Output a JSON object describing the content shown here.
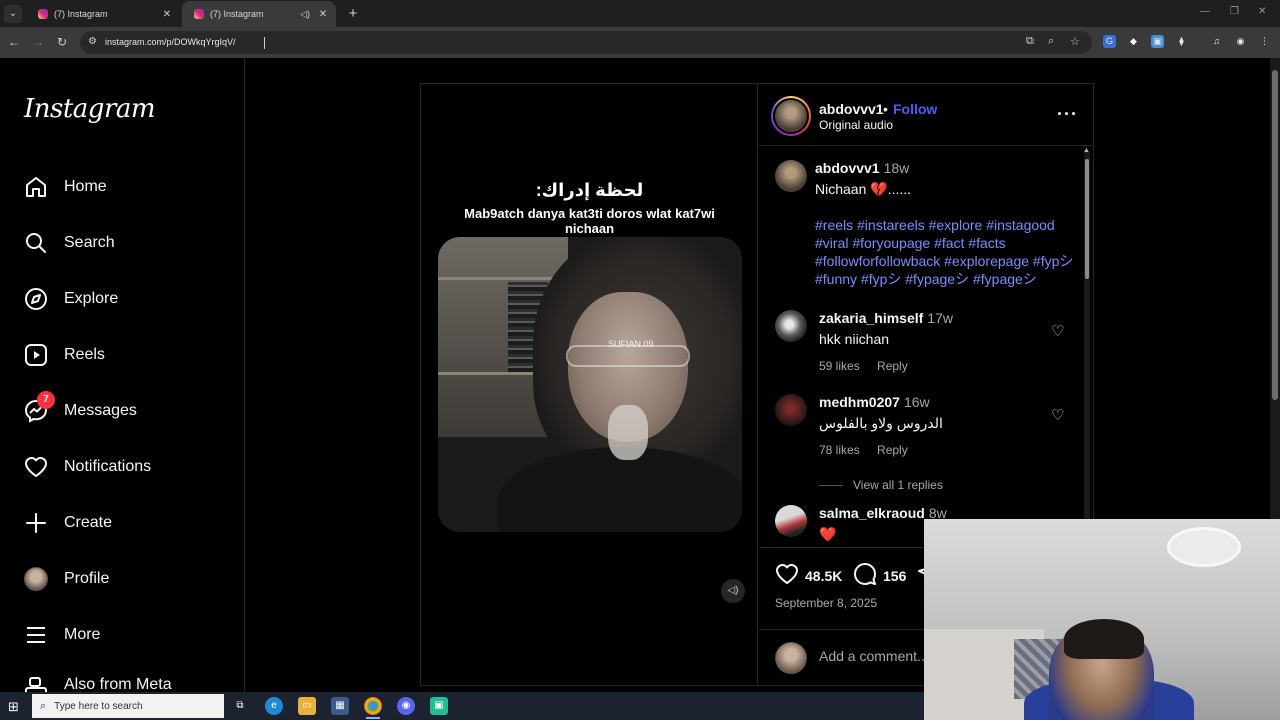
{
  "browser": {
    "tabs": [
      {
        "title": "(7) Instagram",
        "active": false
      },
      {
        "title": "(7) Instagram",
        "active": true
      }
    ],
    "url": "instagram.com/p/DOWkqYrgIqV/"
  },
  "instagram": {
    "logo": "Instagram",
    "nav": [
      {
        "label": "Home",
        "icon": "home-icon"
      },
      {
        "label": "Search",
        "icon": "search-icon"
      },
      {
        "label": "Explore",
        "icon": "compass-icon"
      },
      {
        "label": "Reels",
        "icon": "reels-icon"
      },
      {
        "label": "Messages",
        "icon": "messenger-icon",
        "badge": "7"
      },
      {
        "label": "Notifications",
        "icon": "heart-icon"
      },
      {
        "label": "Create",
        "icon": "plus-icon"
      },
      {
        "label": "Profile",
        "icon": "avatar-icon"
      },
      {
        "label": "More",
        "icon": "menu-icon"
      },
      {
        "label": "Also from Meta",
        "icon": "meta-icon"
      }
    ]
  },
  "post": {
    "media": {
      "title_arabic": "لحظة إدراك:",
      "subtitle": "Mab9atch danya kat3ti doros wlat kat7wi nichaan",
      "watermark": "SUFIAN.09"
    },
    "author": {
      "username": "abdovvv1",
      "dot": "•",
      "follow_label": "Follow",
      "audio": "Original audio"
    },
    "caption": {
      "username": "abdovvv1",
      "time": "18w",
      "text": "Nichaan 💔......",
      "hashtags": "#reels #instareels #explore #instagood #viral #foryoupage #fact #facts #followforfollowback #explorepage #fypシ #funny #fypシ #fypageシ #fypageシ"
    },
    "comments": [
      {
        "username": "zakaria_himself",
        "time": "17w",
        "text": "hkk niichan",
        "likes": "59 likes",
        "reply": "Reply"
      },
      {
        "username": "medhm0207",
        "time": "16w",
        "text": "الدروس ولاو بالفلوس",
        "likes": "78 likes",
        "reply": "Reply",
        "view_replies": "View all 1 replies"
      },
      {
        "username": "salma_elkraoud",
        "time": "8w",
        "text": "❤️"
      }
    ],
    "actions": {
      "likes": "48.5K",
      "comments": "156"
    },
    "date": "September 8, 2025",
    "comment_placeholder": "Add a comment..."
  },
  "taskbar": {
    "search_placeholder": "Type here to search"
  },
  "colors": {
    "link_blue": "#4a5df9",
    "hashtag_blue": "#7b8cff",
    "badge_red": "#ff3040"
  }
}
